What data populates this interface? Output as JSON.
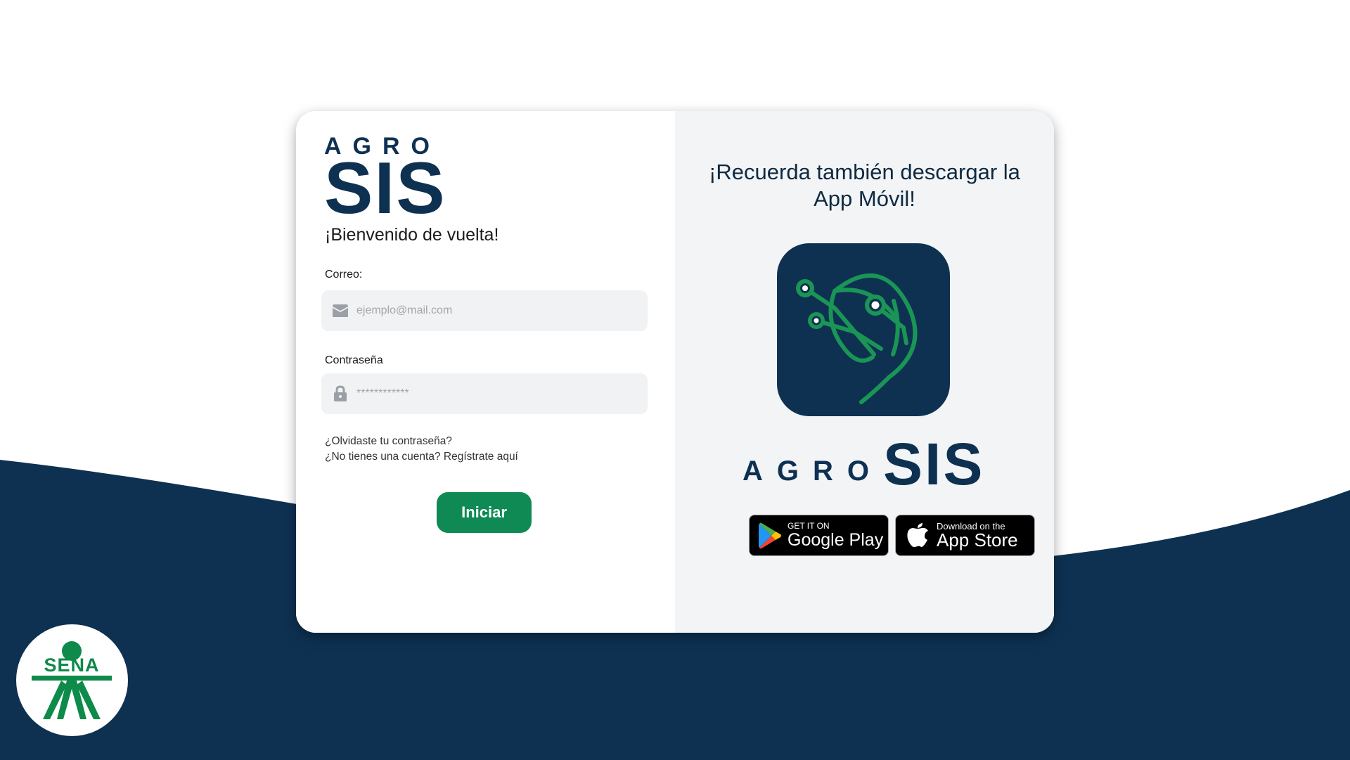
{
  "colors": {
    "navy": "#0e3152",
    "green": "#0f8a55",
    "leaf_green": "#1a9556",
    "sena_green": "#0e8a4a"
  },
  "login": {
    "logo_agro": "AGRO",
    "logo_sis": "SIS",
    "welcome": "¡Bienvenido de vuelta!",
    "email_label": "Correo:",
    "email_placeholder": "ejemplo@mail.com",
    "email_icon": "envelope-icon",
    "password_label": "Contraseña",
    "password_placeholder": "************",
    "password_icon": "lock-icon",
    "forgot_link": "¿Olvidaste tu contraseña?",
    "register_link": "¿No tienes una cuenta? Regístrate aquí",
    "submit_label": "Iniciar"
  },
  "promo": {
    "title_line1": "¡Recuerda también descargar la",
    "title_line2": "App Móvil!",
    "logo_agro": "AGRO",
    "logo_sis": "SIS",
    "app_icon": "leaf-circuit-icon",
    "google_play_small": "GET IT ON",
    "google_play_big": "Google Play",
    "app_store_small": "Download on the",
    "app_store_big": "App Store"
  },
  "footer": {
    "sena_text": "SENA"
  }
}
